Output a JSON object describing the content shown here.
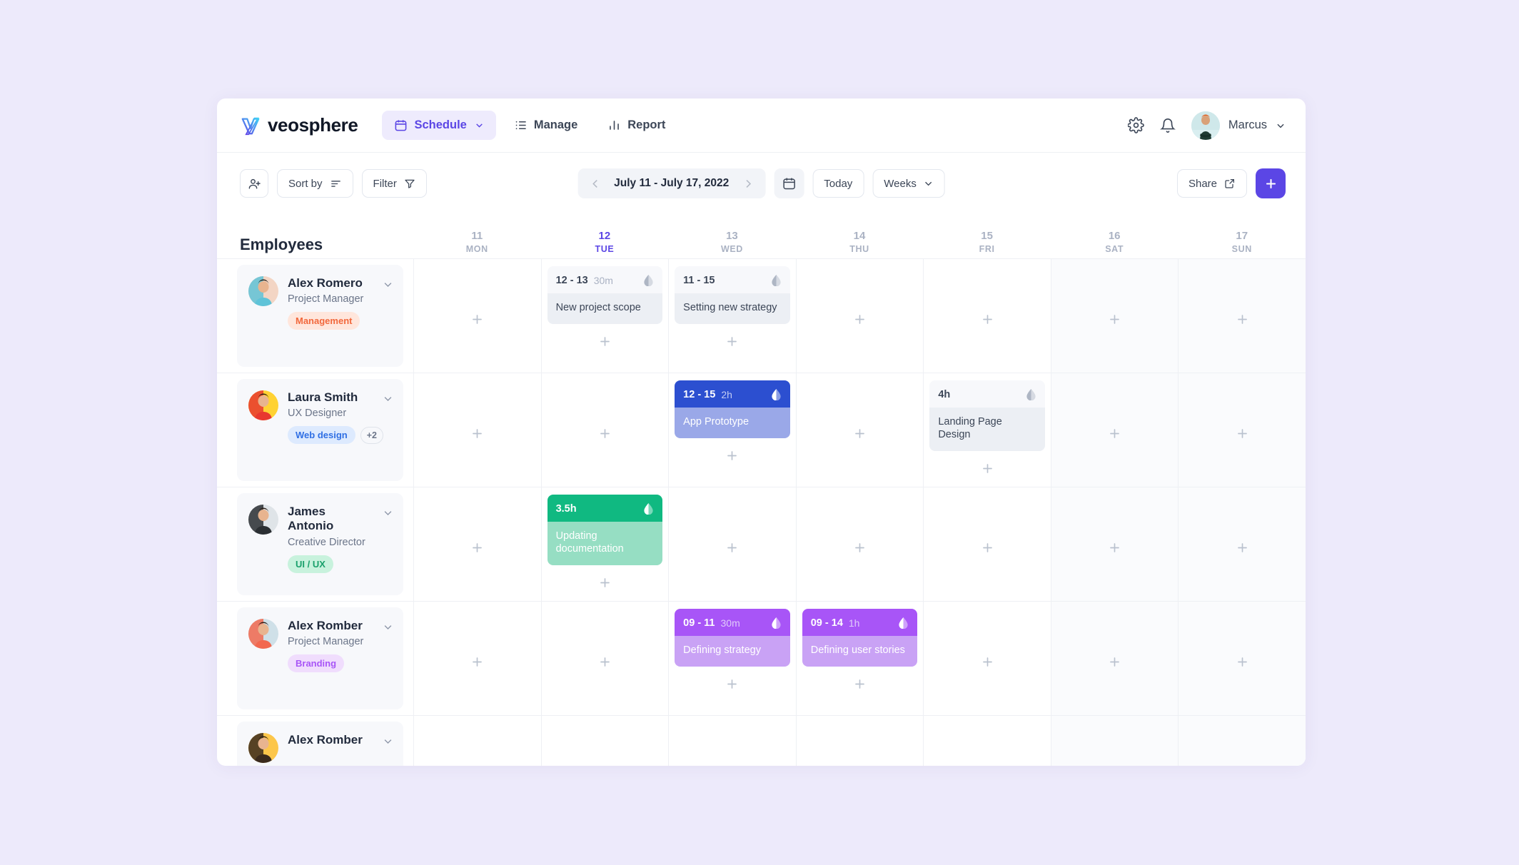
{
  "brand": {
    "name": "veosphere",
    "accent": "#5b46e5"
  },
  "nav": {
    "items": [
      {
        "label": "Schedule",
        "icon": "calendar-icon",
        "active": true,
        "caret": true
      },
      {
        "label": "Manage",
        "icon": "list-icon",
        "active": false,
        "caret": false
      },
      {
        "label": "Report",
        "icon": "bar-chart-icon",
        "active": false,
        "caret": false
      }
    ],
    "settings_icon": "gear-icon",
    "notifications_icon": "bell-icon",
    "user": {
      "name": "Marcus",
      "avatar": "user-avatar",
      "caret": "chevron-down-icon"
    }
  },
  "toolbar": {
    "add_person_icon": "add-person-icon",
    "sort_label": "Sort by",
    "sort_icon": "sort-icon",
    "filter_label": "Filter",
    "filter_icon": "funnel-icon",
    "date_range": "July 11 - July 17, 2022",
    "prev_icon": "chevron-left-icon",
    "next_icon": "chevron-right-icon",
    "calendar_icon": "calendar-icon",
    "today_label": "Today",
    "view_label": "Weeks",
    "view_caret": "chevron-down-icon",
    "share_label": "Share",
    "share_icon": "external-link-icon",
    "add_label": "+"
  },
  "grid": {
    "employees_header": "Employees",
    "days": [
      {
        "num": "11",
        "name": "MON",
        "today": false,
        "weekend": false
      },
      {
        "num": "12",
        "name": "TUE",
        "today": true,
        "weekend": false
      },
      {
        "num": "13",
        "name": "WED",
        "today": false,
        "weekend": false
      },
      {
        "num": "14",
        "name": "THU",
        "today": false,
        "weekend": false
      },
      {
        "num": "15",
        "name": "FRI",
        "today": false,
        "weekend": false
      },
      {
        "num": "16",
        "name": "SAT",
        "today": false,
        "weekend": true
      },
      {
        "num": "17",
        "name": "SUN",
        "today": false,
        "weekend": true
      }
    ]
  },
  "rows": [
    {
      "name": "Alex Romero",
      "role": "Project Manager",
      "tags": [
        {
          "label": "Management",
          "bg": "#ffe6dc",
          "color": "#f2683c"
        }
      ],
      "more": null,
      "avatar_colors": [
        "#f3d5c4",
        "#5fc3d8"
      ],
      "events": {
        "1": {
          "time": "12 - 13",
          "dur": "30m",
          "title": "New project scope",
          "head_bg": "#f7f8fb",
          "body_bg": "#eceff4",
          "time_color": "#3c4657",
          "dur_color": "#aab2c3",
          "body_color": "#3c4657",
          "drop_color": "#aeb6c4"
        },
        "2": {
          "time": "11 - 15",
          "dur": "",
          "title": "Setting new strategy",
          "head_bg": "#f7f8fb",
          "body_bg": "#eceff4",
          "time_color": "#3c4657",
          "dur_color": "#aab2c3",
          "body_color": "#3c4657",
          "drop_color": "#aeb6c4"
        }
      }
    },
    {
      "name": "Laura Smith",
      "role": "UX Designer",
      "tags": [
        {
          "label": "Web design",
          "bg": "#ddeafe",
          "color": "#2f6fe4"
        }
      ],
      "more": "+2",
      "avatar_colors": [
        "#ffd233",
        "#e8392f"
      ],
      "events": {
        "2": {
          "time": "12 - 15",
          "dur": "2h",
          "title": "App Prototype",
          "head_bg": "#2c4fd0",
          "body_bg": "#9aa8e8",
          "time_color": "#ffffff",
          "dur_color": "#c3ccf3",
          "body_color": "#ffffff",
          "drop_color": "#ffffff"
        },
        "4": {
          "time": "4h",
          "dur": "",
          "title": "Landing Page Design",
          "head_bg": "#f7f8fb",
          "body_bg": "#eceff4",
          "time_color": "#3c4657",
          "dur_color": "#aab2c3",
          "body_color": "#3c4657",
          "drop_color": "#aeb6c4"
        }
      }
    },
    {
      "name": "James Antonio",
      "role": "Creative Director",
      "tags": [
        {
          "label": "UI / UX",
          "bg": "#c8f2dd",
          "color": "#19a06b"
        }
      ],
      "more": null,
      "avatar_colors": [
        "#dfe4e8",
        "#2b2f33"
      ],
      "events": {
        "1": {
          "time": "3.5h",
          "dur": "",
          "title": "Updating documentation",
          "head_bg": "#10b981",
          "body_bg": "#96dec3",
          "time_color": "#ffffff",
          "dur_color": "#d2f2e4",
          "body_color": "#ffffff",
          "drop_color": "#ffffff"
        }
      }
    },
    {
      "name": "Alex Romber",
      "role": "Project Manager",
      "tags": [
        {
          "label": "Branding",
          "bg": "#f0ddfd",
          "color": "#a855f7"
        }
      ],
      "more": null,
      "avatar_colors": [
        "#cfe0e8",
        "#f2684f"
      ],
      "events": {
        "2": {
          "time": "09 - 11",
          "dur": "30m",
          "title": "Defining strategy",
          "head_bg": "#a855f7",
          "body_bg": "#c9a2f5",
          "time_color": "#ffffff",
          "dur_color": "#e0cafb",
          "body_color": "#ffffff",
          "drop_color": "#ffffff"
        },
        "3": {
          "time": "09 - 14",
          "dur": "1h",
          "title": "Defining user stories",
          "head_bg": "#a855f7",
          "body_bg": "#c9a2f5",
          "time_color": "#ffffff",
          "dur_color": "#e0cafb",
          "body_color": "#ffffff",
          "drop_color": "#ffffff"
        }
      }
    },
    {
      "name": "Alex Romber",
      "role": "",
      "tags": [],
      "more": null,
      "avatar_colors": [
        "#fcc64a",
        "#3a2a1d"
      ],
      "events": {}
    }
  ]
}
